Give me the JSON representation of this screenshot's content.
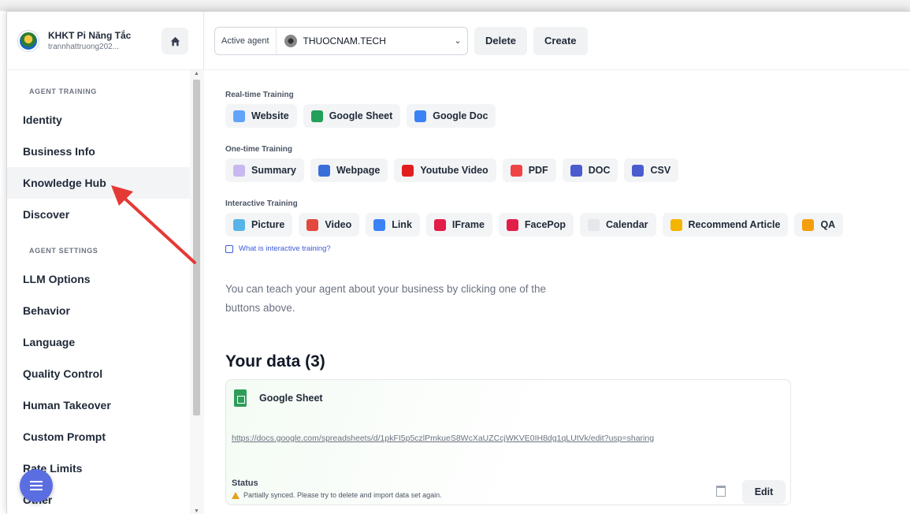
{
  "brand": {
    "name": "KHKT Pi Năng Tắc",
    "user": "trannhattruong202..."
  },
  "sidebar": {
    "section_training": "AGENT TRAINING",
    "training_items": [
      "Identity",
      "Business Info",
      "Knowledge Hub",
      "Discover"
    ],
    "active_item": "Knowledge Hub",
    "section_settings": "AGENT SETTINGS",
    "settings_items": [
      "LLM Options",
      "Behavior",
      "Language",
      "Quality Control",
      "Human Takeover",
      "Custom Prompt",
      "Rate Limits",
      "Other"
    ]
  },
  "topbar": {
    "active_agent_label": "Active agent",
    "agent_name": "THUOCNAM.TECH",
    "delete_label": "Delete",
    "create_label": "Create"
  },
  "training": {
    "realtime_title": "Real-time Training",
    "realtime": [
      {
        "label": "Website",
        "icon": "globe-icon",
        "color": "#60a5fa"
      },
      {
        "label": "Google Sheet",
        "icon": "google-sheet-icon",
        "color": "#22a05a"
      },
      {
        "label": "Google Doc",
        "icon": "google-doc-icon",
        "color": "#3b82f6"
      }
    ],
    "onetime_title": "One-time Training",
    "onetime": [
      {
        "label": "Summary",
        "icon": "document-icon",
        "color": "#c7b8f0"
      },
      {
        "label": "Webpage",
        "icon": "code-page-icon",
        "color": "#3b6fd8"
      },
      {
        "label": "Youtube Video",
        "icon": "youtube-icon",
        "color": "#e11d1d"
      },
      {
        "label": "PDF",
        "icon": "pdf-icon",
        "color": "#ef4444"
      },
      {
        "label": "DOC",
        "icon": "doc-icon",
        "color": "#4b5ccf"
      },
      {
        "label": "CSV",
        "icon": "csv-icon",
        "color": "#4b5ccf"
      }
    ],
    "interactive_title": "Interactive Training",
    "interactive": [
      {
        "label": "Picture",
        "icon": "picture-icon",
        "color": "#56b4e9"
      },
      {
        "label": "Video",
        "icon": "film-icon",
        "color": "#e2483d"
      },
      {
        "label": "Link",
        "icon": "link-icon",
        "color": "#3b82f6"
      },
      {
        "label": "IFrame",
        "icon": "iframe-icon",
        "color": "#e11d48"
      },
      {
        "label": "FacePop",
        "icon": "facepop-icon",
        "color": "#e11d48"
      },
      {
        "label": "Calendar",
        "icon": "calendar-icon",
        "color": "#e5e7eb"
      },
      {
        "label": "Recommend Article",
        "icon": "star-icon",
        "color": "#f5b400"
      },
      {
        "label": "QA",
        "icon": "question-icon",
        "color": "#f59e0b"
      }
    ],
    "interactive_help_link": "What is interactive training?"
  },
  "help_text": "You can teach your agent about your business by clicking one of the buttons above.",
  "your_data": {
    "title": "Your data (3)",
    "card": {
      "type": "Google Sheet",
      "url": "https://docs.google.com/spreadsheets/d/1pkFI5p5czlPmkueS8WcXaUZCcjWKVE0IH8dg1qLUtVk/edit?usp=sharing",
      "status_label": "Status",
      "status_text": "Partially synced. Please try to delete and import data set again.",
      "edit_label": "Edit"
    }
  }
}
